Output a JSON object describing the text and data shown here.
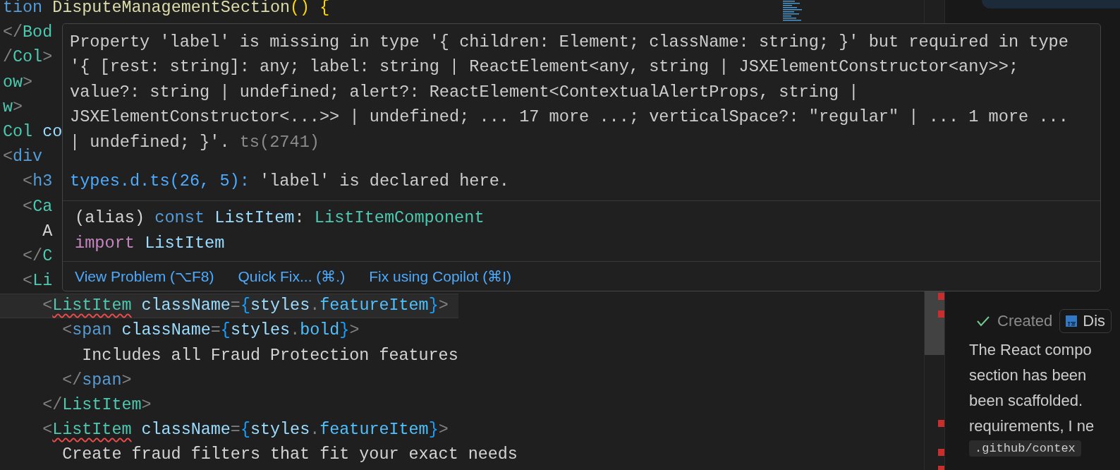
{
  "editor": {
    "lines": [
      {
        "current": false,
        "tokens": [
          {
            "kind": "keyword",
            "text": "tion"
          },
          {
            "kind": "function",
            "text": " DisputeManagementSection"
          },
          {
            "kind": "paren",
            "text": "()"
          },
          {
            "kind": "paren",
            "text": " {"
          }
        ]
      },
      {
        "current": false,
        "tokens": [
          {
            "kind": "punct",
            "text": "</"
          },
          {
            "kind": "tag",
            "text": "Bod"
          }
        ]
      },
      {
        "current": false,
        "tokens": [
          {
            "kind": "punct",
            "text": "/"
          },
          {
            "kind": "tag",
            "text": "Col"
          },
          {
            "kind": "punct",
            "text": ">"
          }
        ]
      },
      {
        "current": false,
        "tokens": [
          {
            "kind": "tag",
            "text": "ow"
          },
          {
            "kind": "punct",
            "text": ">"
          }
        ]
      },
      {
        "current": false,
        "tokens": [
          {
            "kind": "tag",
            "text": "w"
          },
          {
            "kind": "punct",
            "text": ">"
          }
        ]
      },
      {
        "current": false,
        "tokens": [
          {
            "kind": "tag",
            "text": "Col"
          },
          {
            "kind": "attr",
            "text": " co"
          }
        ]
      },
      {
        "current": false,
        "tokens": [
          {
            "kind": "punct",
            "text": "<"
          },
          {
            "kind": "keyword",
            "text": "div"
          }
        ]
      },
      {
        "current": false,
        "tokens": [
          {
            "kind": "punct",
            "text": "  <"
          },
          {
            "kind": "keyword",
            "text": "h3"
          }
        ]
      },
      {
        "current": false,
        "tokens": [
          {
            "kind": "punct",
            "text": "  <"
          },
          {
            "kind": "tag",
            "text": "Ca"
          }
        ]
      },
      {
        "current": false,
        "tokens": [
          {
            "kind": "text",
            "text": "    A"
          }
        ]
      },
      {
        "current": false,
        "tokens": [
          {
            "kind": "punct",
            "text": "  </"
          },
          {
            "kind": "tag",
            "text": "C"
          }
        ]
      },
      {
        "current": false,
        "tokens": [
          {
            "kind": "punct",
            "text": "  <"
          },
          {
            "kind": "tag",
            "text": "Li"
          }
        ]
      },
      {
        "current": true,
        "tokens": [
          {
            "kind": "punct",
            "text": "    <"
          },
          {
            "kind": "tag-error",
            "text": "ListItem"
          },
          {
            "kind": "attr",
            "text": " className"
          },
          {
            "kind": "punct",
            "text": "="
          },
          {
            "kind": "brace",
            "text": "{"
          },
          {
            "kind": "attr",
            "text": "styles"
          },
          {
            "kind": "punct",
            "text": "."
          },
          {
            "kind": "prop",
            "text": "featureItem"
          },
          {
            "kind": "brace",
            "text": "}"
          },
          {
            "kind": "punct",
            "text": ">"
          }
        ]
      },
      {
        "current": false,
        "tokens": [
          {
            "kind": "punct",
            "text": "      <"
          },
          {
            "kind": "keyword",
            "text": "span"
          },
          {
            "kind": "attr",
            "text": " className"
          },
          {
            "kind": "punct",
            "text": "="
          },
          {
            "kind": "brace",
            "text": "{"
          },
          {
            "kind": "attr",
            "text": "styles"
          },
          {
            "kind": "punct",
            "text": "."
          },
          {
            "kind": "prop",
            "text": "bold"
          },
          {
            "kind": "brace",
            "text": "}"
          },
          {
            "kind": "punct",
            "text": ">"
          }
        ]
      },
      {
        "current": false,
        "tokens": [
          {
            "kind": "text",
            "text": "        Includes all Fraud Protection features"
          }
        ]
      },
      {
        "current": false,
        "tokens": [
          {
            "kind": "punct",
            "text": "      </"
          },
          {
            "kind": "keyword",
            "text": "span"
          },
          {
            "kind": "punct",
            "text": ">"
          }
        ]
      },
      {
        "current": false,
        "tokens": [
          {
            "kind": "punct",
            "text": "    </"
          },
          {
            "kind": "tag",
            "text": "ListItem"
          },
          {
            "kind": "punct",
            "text": ">"
          }
        ]
      },
      {
        "current": false,
        "tokens": [
          {
            "kind": "punct",
            "text": "    <"
          },
          {
            "kind": "tag-error",
            "text": "ListItem"
          },
          {
            "kind": "attr",
            "text": " className"
          },
          {
            "kind": "punct",
            "text": "="
          },
          {
            "kind": "brace",
            "text": "{"
          },
          {
            "kind": "attr",
            "text": "styles"
          },
          {
            "kind": "punct",
            "text": "."
          },
          {
            "kind": "prop",
            "text": "featureItem"
          },
          {
            "kind": "brace",
            "text": "}"
          },
          {
            "kind": "punct",
            "text": ">"
          }
        ]
      },
      {
        "current": false,
        "tokens": [
          {
            "kind": "text",
            "text": "      Create fraud filters that fit your exact needs"
          }
        ]
      }
    ]
  },
  "hover": {
    "message": "Property 'label' is missing in type '{ children: Element; className: string; }' but required in type '{ [rest: string]: any; label: string | ReactElement<any, string | JSXElementConstructor<any>>; value?: string | undefined; alert?: ReactElement<ContextualAlertProps, string | JSXElementConstructor<...>> | undefined; ... 17 more ...; verticalSpace?: \"regular\" | ... 1 more ... | undefined; }'.",
    "code": "ts(2741)",
    "related": {
      "link": "types.d.ts(26, 5):",
      "text": " 'label' is declared here."
    },
    "signature": [
      [
        {
          "kind": "paren-plain",
          "text": "(alias) "
        },
        {
          "kind": "keyword",
          "text": "const "
        },
        {
          "kind": "attr",
          "text": "ListItem"
        },
        {
          "kind": "punct-plain",
          "text": ": "
        },
        {
          "kind": "tag",
          "text": "ListItemComponent"
        }
      ],
      [
        {
          "kind": "import",
          "text": "import "
        },
        {
          "kind": "attr",
          "text": "ListItem"
        }
      ]
    ],
    "actions": [
      "View Problem (⌥F8)",
      "Quick Fix... (⌘.)",
      "Fix using Copilot (⌘I)"
    ]
  },
  "chat": {
    "status": "Created",
    "file": "Dis",
    "lines": [
      "The React compo",
      "section has been",
      "been scaffolded.",
      "requirements, I ne"
    ],
    "code": ".github/contex"
  }
}
